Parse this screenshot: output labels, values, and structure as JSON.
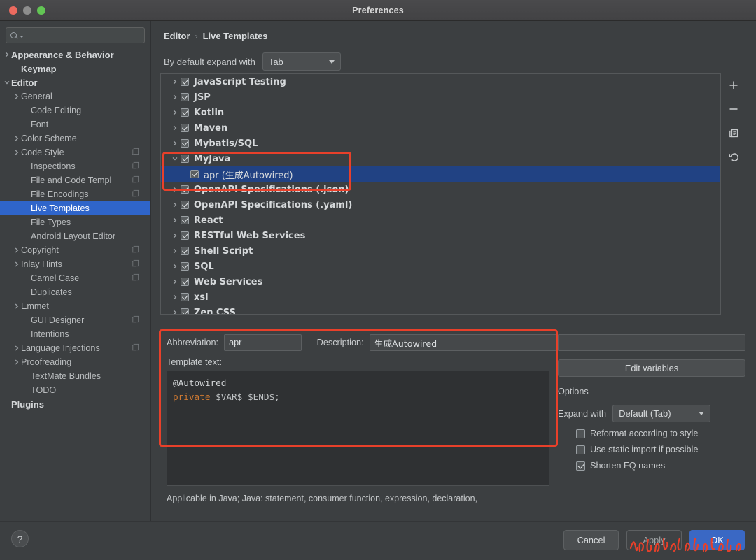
{
  "window": {
    "title": "Preferences"
  },
  "search": {
    "placeholder": "",
    "value": ""
  },
  "sidebar": {
    "items": [
      {
        "label": "Appearance & Behavior",
        "arrow": "right",
        "bold": true,
        "indent": 0,
        "copy": false,
        "selected": false
      },
      {
        "label": "Keymap",
        "arrow": "none",
        "bold": true,
        "indent": 1,
        "copy": false,
        "selected": false
      },
      {
        "label": "Editor",
        "arrow": "down",
        "bold": true,
        "indent": 0,
        "copy": false,
        "selected": false
      },
      {
        "label": "General",
        "arrow": "right",
        "bold": false,
        "indent": 1,
        "copy": false,
        "selected": false
      },
      {
        "label": "Code Editing",
        "arrow": "none",
        "bold": false,
        "indent": 2,
        "copy": false,
        "selected": false
      },
      {
        "label": "Font",
        "arrow": "none",
        "bold": false,
        "indent": 2,
        "copy": false,
        "selected": false
      },
      {
        "label": "Color Scheme",
        "arrow": "right",
        "bold": false,
        "indent": 1,
        "copy": false,
        "selected": false
      },
      {
        "label": "Code Style",
        "arrow": "right",
        "bold": false,
        "indent": 1,
        "copy": true,
        "selected": false
      },
      {
        "label": "Inspections",
        "arrow": "none",
        "bold": false,
        "indent": 2,
        "copy": true,
        "selected": false
      },
      {
        "label": "File and Code Templ",
        "arrow": "none",
        "bold": false,
        "indent": 2,
        "copy": true,
        "selected": false
      },
      {
        "label": "File Encodings",
        "arrow": "none",
        "bold": false,
        "indent": 2,
        "copy": true,
        "selected": false
      },
      {
        "label": "Live Templates",
        "arrow": "none",
        "bold": false,
        "indent": 2,
        "copy": false,
        "selected": true
      },
      {
        "label": "File Types",
        "arrow": "none",
        "bold": false,
        "indent": 2,
        "copy": false,
        "selected": false
      },
      {
        "label": "Android Layout Editor",
        "arrow": "none",
        "bold": false,
        "indent": 2,
        "copy": false,
        "selected": false
      },
      {
        "label": "Copyright",
        "arrow": "right",
        "bold": false,
        "indent": 1,
        "copy": true,
        "selected": false
      },
      {
        "label": "Inlay Hints",
        "arrow": "right",
        "bold": false,
        "indent": 1,
        "copy": true,
        "selected": false
      },
      {
        "label": "Camel Case",
        "arrow": "none",
        "bold": false,
        "indent": 2,
        "copy": true,
        "selected": false
      },
      {
        "label": "Duplicates",
        "arrow": "none",
        "bold": false,
        "indent": 2,
        "copy": false,
        "selected": false
      },
      {
        "label": "Emmet",
        "arrow": "right",
        "bold": false,
        "indent": 1,
        "copy": false,
        "selected": false
      },
      {
        "label": "GUI Designer",
        "arrow": "none",
        "bold": false,
        "indent": 2,
        "copy": true,
        "selected": false
      },
      {
        "label": "Intentions",
        "arrow": "none",
        "bold": false,
        "indent": 2,
        "copy": false,
        "selected": false
      },
      {
        "label": "Language Injections",
        "arrow": "right",
        "bold": false,
        "indent": 1,
        "copy": true,
        "selected": false
      },
      {
        "label": "Proofreading",
        "arrow": "right",
        "bold": false,
        "indent": 1,
        "copy": false,
        "selected": false
      },
      {
        "label": "TextMate Bundles",
        "arrow": "none",
        "bold": false,
        "indent": 2,
        "copy": false,
        "selected": false
      },
      {
        "label": "TODO",
        "arrow": "none",
        "bold": false,
        "indent": 2,
        "copy": false,
        "selected": false
      },
      {
        "label": "Plugins",
        "arrow": "none",
        "bold": true,
        "indent": 0,
        "copy": false,
        "selected": false
      }
    ]
  },
  "breadcrumb": {
    "root": "Editor",
    "separator": "›",
    "leaf": "Live Templates"
  },
  "expand_default": {
    "label": "By default expand with",
    "value": "Tab"
  },
  "templates_tree": {
    "rows": [
      {
        "label": "JavaScript Testing",
        "arrow": "right",
        "checked": true,
        "child": false,
        "selected": false
      },
      {
        "label": "JSP",
        "arrow": "right",
        "checked": true,
        "child": false,
        "selected": false
      },
      {
        "label": "Kotlin",
        "arrow": "right",
        "checked": true,
        "child": false,
        "selected": false
      },
      {
        "label": "Maven",
        "arrow": "right",
        "checked": true,
        "child": false,
        "selected": false
      },
      {
        "label": "Mybatis/SQL",
        "arrow": "right",
        "checked": true,
        "child": false,
        "selected": false
      },
      {
        "label": "MyJava",
        "arrow": "down",
        "checked": true,
        "child": false,
        "selected": false
      },
      {
        "label": "apr (生成Autowired)",
        "arrow": "none",
        "checked": true,
        "child": true,
        "selected": true
      },
      {
        "label": "OpenAPI Specifications (.json)",
        "arrow": "right",
        "checked": true,
        "child": false,
        "selected": false
      },
      {
        "label": "OpenAPI Specifications (.yaml)",
        "arrow": "right",
        "checked": true,
        "child": false,
        "selected": false
      },
      {
        "label": "React",
        "arrow": "right",
        "checked": true,
        "child": false,
        "selected": false
      },
      {
        "label": "RESTful Web Services",
        "arrow": "right",
        "checked": true,
        "child": false,
        "selected": false
      },
      {
        "label": "Shell Script",
        "arrow": "right",
        "checked": true,
        "child": false,
        "selected": false
      },
      {
        "label": "SQL",
        "arrow": "right",
        "checked": true,
        "child": false,
        "selected": false
      },
      {
        "label": "Web Services",
        "arrow": "right",
        "checked": true,
        "child": false,
        "selected": false
      },
      {
        "label": "xsl",
        "arrow": "right",
        "checked": true,
        "child": false,
        "selected": false
      },
      {
        "label": "Zen CSS",
        "arrow": "right",
        "checked": true,
        "child": false,
        "selected": false
      }
    ]
  },
  "tree_toolbar": {
    "add": "add-icon",
    "remove": "remove-icon",
    "duplicate": "duplicate-icon",
    "revert": "revert-icon"
  },
  "detail": {
    "abbreviation_label": "Abbreviation:",
    "abbreviation_value": "apr",
    "description_label": "Description:",
    "description_value": "生成Autowired",
    "template_text_label": "Template text:",
    "code_line1": "@Autowired",
    "code_kw": "private",
    "code_rest": " $VAR$ $END$;",
    "applicable": "Applicable in Java; Java: statement, consumer function, expression, declaration,"
  },
  "options": {
    "edit_variables": "Edit variables",
    "legend": "Options",
    "expand_with_label": "Expand with",
    "expand_with_value": "Default (Tab)",
    "checkboxes": [
      {
        "label": "Reformat according to style",
        "checked": false
      },
      {
        "label": "Use static import if possible",
        "checked": false
      },
      {
        "label": "Shorten FQ names",
        "checked": true
      }
    ]
  },
  "footer": {
    "help": "?",
    "cancel": "Cancel",
    "apply": "Apply",
    "ok": "OK"
  },
  "colors": {
    "accent_selection": "#2f65ca",
    "tree_selection": "#214283",
    "annotation_red": "#e8402a",
    "primary_button": "#3a68c4",
    "keyword_orange": "#cc7832",
    "window_bg": "#3c3f41"
  }
}
